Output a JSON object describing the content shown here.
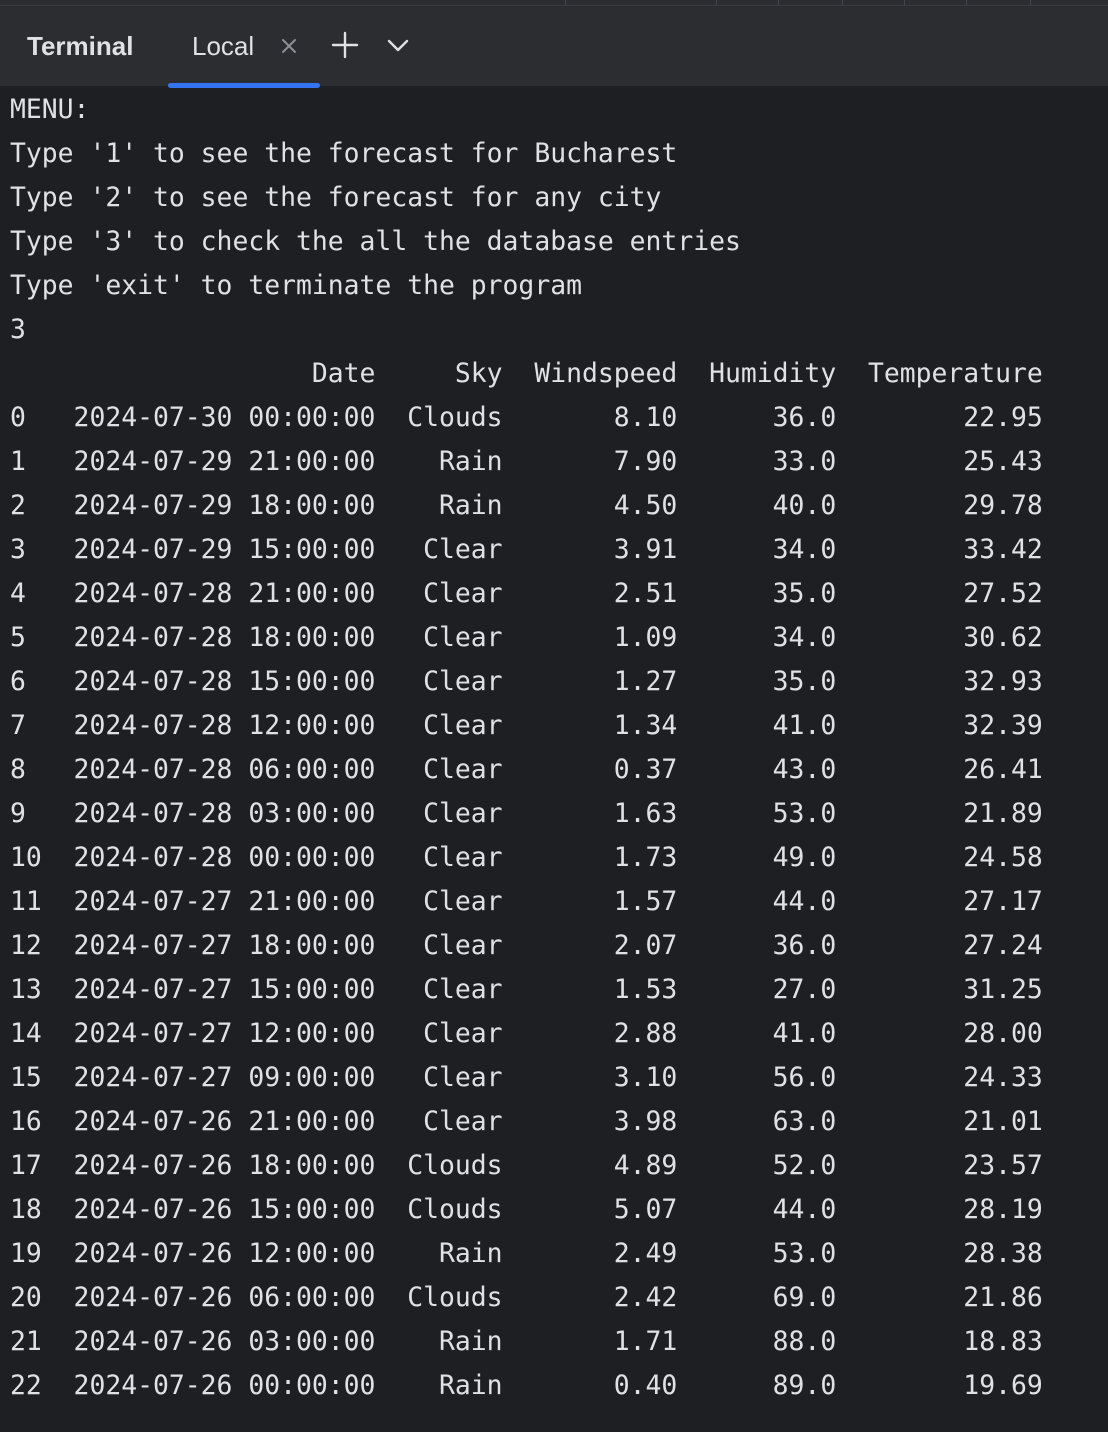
{
  "toolwindow": {
    "title": "Terminal",
    "tabs": [
      {
        "label": "Local",
        "active": true
      }
    ],
    "icons": {
      "close": "close-icon",
      "add": "plus-icon",
      "more": "chevron-down-icon"
    },
    "colors": {
      "accent": "#3574f0",
      "toolbar_bg": "#2b2d30",
      "terminal_bg": "#1e1f22",
      "text": "#dfe1e5"
    }
  },
  "terminal": {
    "menu_lines": [
      "MENU:",
      "Type '1' to see the forecast for Bucharest",
      "Type '2' to see the forecast for any city",
      "Type '3' to check the all the database entries",
      "Type 'exit' to terminate the program",
      "3"
    ],
    "table": {
      "columns": [
        "Date",
        "Sky",
        "Windspeed",
        "Humidity",
        "Temperature"
      ],
      "rows": [
        [
          "0",
          "2024-07-30 00:00:00",
          "Clouds",
          "8.10",
          "36.0",
          "22.95"
        ],
        [
          "1",
          "2024-07-29 21:00:00",
          "Rain",
          "7.90",
          "33.0",
          "25.43"
        ],
        [
          "2",
          "2024-07-29 18:00:00",
          "Rain",
          "4.50",
          "40.0",
          "29.78"
        ],
        [
          "3",
          "2024-07-29 15:00:00",
          "Clear",
          "3.91",
          "34.0",
          "33.42"
        ],
        [
          "4",
          "2024-07-28 21:00:00",
          "Clear",
          "2.51",
          "35.0",
          "27.52"
        ],
        [
          "5",
          "2024-07-28 18:00:00",
          "Clear",
          "1.09",
          "34.0",
          "30.62"
        ],
        [
          "6",
          "2024-07-28 15:00:00",
          "Clear",
          "1.27",
          "35.0",
          "32.93"
        ],
        [
          "7",
          "2024-07-28 12:00:00",
          "Clear",
          "1.34",
          "41.0",
          "32.39"
        ],
        [
          "8",
          "2024-07-28 06:00:00",
          "Clear",
          "0.37",
          "43.0",
          "26.41"
        ],
        [
          "9",
          "2024-07-28 03:00:00",
          "Clear",
          "1.63",
          "53.0",
          "21.89"
        ],
        [
          "10",
          "2024-07-28 00:00:00",
          "Clear",
          "1.73",
          "49.0",
          "24.58"
        ],
        [
          "11",
          "2024-07-27 21:00:00",
          "Clear",
          "1.57",
          "44.0",
          "27.17"
        ],
        [
          "12",
          "2024-07-27 18:00:00",
          "Clear",
          "2.07",
          "36.0",
          "27.24"
        ],
        [
          "13",
          "2024-07-27 15:00:00",
          "Clear",
          "1.53",
          "27.0",
          "31.25"
        ],
        [
          "14",
          "2024-07-27 12:00:00",
          "Clear",
          "2.88",
          "41.0",
          "28.00"
        ],
        [
          "15",
          "2024-07-27 09:00:00",
          "Clear",
          "3.10",
          "56.0",
          "24.33"
        ],
        [
          "16",
          "2024-07-26 21:00:00",
          "Clear",
          "3.98",
          "63.0",
          "21.01"
        ],
        [
          "17",
          "2024-07-26 18:00:00",
          "Clouds",
          "4.89",
          "52.0",
          "23.57"
        ],
        [
          "18",
          "2024-07-26 15:00:00",
          "Clouds",
          "5.07",
          "44.0",
          "28.19"
        ],
        [
          "19",
          "2024-07-26 12:00:00",
          "Rain",
          "2.49",
          "53.0",
          "28.38"
        ],
        [
          "20",
          "2024-07-26 06:00:00",
          "Clouds",
          "2.42",
          "69.0",
          "21.86"
        ],
        [
          "21",
          "2024-07-26 03:00:00",
          "Rain",
          "1.71",
          "88.0",
          "18.83"
        ],
        [
          "22",
          "2024-07-26 00:00:00",
          "Rain",
          "0.40",
          "89.0",
          "19.69"
        ]
      ]
    }
  }
}
